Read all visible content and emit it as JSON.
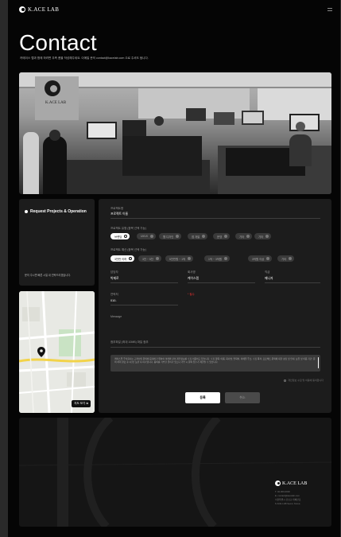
{
  "header": {
    "brand": "K.ACE LAB",
    "menu_icon": "hamburger-icon"
  },
  "page": {
    "title": "Contact",
    "description": "카에이스 랩과 함께 하려면 우측 폼을 작성해주세요. 이메일 문의 contact@kacelab.com 으로 주셔도 됩니다."
  },
  "photo": {
    "sign": "K.ACE LAB"
  },
  "request": {
    "title": "Request Projects & Operation",
    "note": "문의 주시면 빠른 시일 내 연락드리겠습니다."
  },
  "map": {
    "button_label": "지도 보기"
  },
  "form": {
    "company_label": "프로젝트명",
    "company_value": "프로젝트 이름",
    "type_label": "프로젝트 유형 (중복 선택 가능)",
    "type_chips": [
      "브랜딩",
      "UI/UX",
      "웹 디자인",
      "앱 개발",
      "운영",
      "기타",
      "기타"
    ],
    "budget_label": "프로젝트 예산 (중복 선택 가능)",
    "budget_chips": [
      "3천만 이하",
      "3천 ~ 5천",
      "5천만원 ~ 1억",
      "1억 ~ 3억원",
      "3억원 이상",
      "기타"
    ],
    "name_label": "담당자",
    "name_value": "박제로",
    "company2_label": "회사명",
    "company2_value": "케이스랩",
    "title2_label": "직급",
    "title2_value": "매니저",
    "phone_label": "연락처",
    "phone_value": "010-",
    "required_note": "* 필수",
    "message_label": "Message",
    "file_label": "첨부파일 (최대 10MB) 파일 첨부",
    "privacy_text": "케이스랩 주식회사는 고객님의 문의에 응대하기 위하여 아래와 같이 개인정보를 수집·이용하고 있습니다. 수집 항목: 이름, 회사명, 연락처, 이메일 주소. 수집 목적: 프로젝트 문의에 대한 상담 및 안내. 보유 및 이용 기간: 문의 처리 완료 후 1년간 보관 후 파기합니다. 동의를 거부할 권리가 있으나 거부 시 문의 접수가 제한될 수 있습니다.",
    "agree_label": "개인정보 수집 및 이용에 동의합니다",
    "submit_label": "등록",
    "cancel_label": "취소"
  },
  "footer": {
    "brand": "K.ACE LAB",
    "info": [
      "T. 02-000-0000",
      "E. contact@kacelab.com",
      "서울특별시 강남구 테헤란로",
      "K.ACE LAB Seoul, Korea"
    ]
  }
}
